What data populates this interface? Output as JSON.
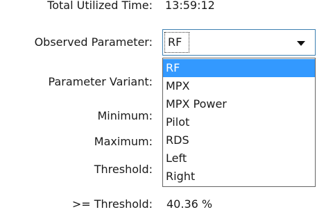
{
  "stats": {
    "total_time_label": "Total Utilized Time:",
    "total_time_value": "13:59:12",
    "threshold_pct_label": ">= Threshold:",
    "threshold_pct_value": "40.36 %"
  },
  "form": {
    "observed_parameter_label": "Observed Parameter:",
    "observed_parameter_value": "RF",
    "parameter_variant_label": "Parameter Variant:",
    "minimum_label": "Minimum:",
    "maximum_label": "Maximum:",
    "threshold_label": "Threshold:"
  },
  "dropdown": {
    "options": [
      "RF",
      "MPX",
      "MPX Power",
      "Pilot",
      "RDS",
      "Left",
      "Right"
    ],
    "selected_index": 0,
    "highlight_color": "#3399ff"
  },
  "icons": {
    "combo_arrow": "chevron-down-icon"
  }
}
